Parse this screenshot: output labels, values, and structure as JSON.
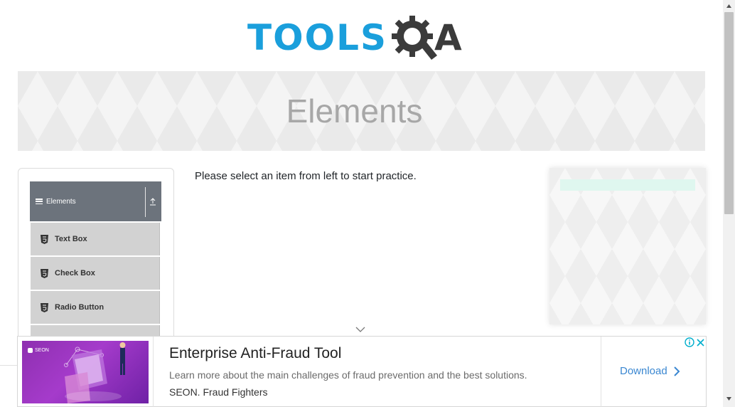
{
  "logo": {
    "tools_text": "TOOLS",
    "a_text": "A"
  },
  "banner": {
    "title": "Elements"
  },
  "sidebar": {
    "group": {
      "label": "Elements"
    },
    "items": [
      {
        "label": "Text Box"
      },
      {
        "label": "Check Box"
      },
      {
        "label": "Radio Button"
      }
    ]
  },
  "main": {
    "instruction": "Please select an item from left to start practice."
  },
  "ad": {
    "brand": "SEON",
    "title": "Enterprise Anti-Fraud Tool",
    "description": "Learn more about the main challenges of fraud prevention and the best solutions.",
    "source": "SEON. Fraud Fighters",
    "cta_label": "Download"
  },
  "colors": {
    "brand_blue": "#1a9fdc",
    "brand_dark": "#3b3b3b",
    "group_header_bg": "#6c737c",
    "menu_item_bg": "#d2d2d2",
    "ad_cta": "#3a87d1",
    "ad_image_purple": "#8e2fb0"
  },
  "icons": {
    "logo_gear": "gear-magnifier-icon",
    "menu": "hamburger-icon",
    "collapse": "arrow-up-icon",
    "menu_item": "html5-icon",
    "scroll_hint": "chevron-down-icon",
    "ad_cta": "chevron-right-icon",
    "ad_info": "info-icon",
    "ad_close": "close-icon"
  }
}
